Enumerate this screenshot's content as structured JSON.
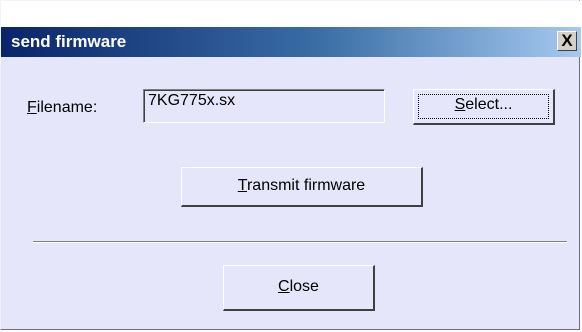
{
  "window": {
    "title": "send firmware",
    "close_glyph": "X",
    "colors": {
      "titlebar_start": "#0a246a",
      "titlebar_end": "#a6caf0",
      "body": "#e6e6fa"
    }
  },
  "form": {
    "filename_label_first": "F",
    "filename_label_rest": "ilename:",
    "filename_value": "7KG775x.sx"
  },
  "buttons": {
    "select_first": "S",
    "select_rest": "elect...",
    "transmit_first": "T",
    "transmit_rest": "ransmit firmware",
    "close_first": "C",
    "close_rest": "lose"
  }
}
